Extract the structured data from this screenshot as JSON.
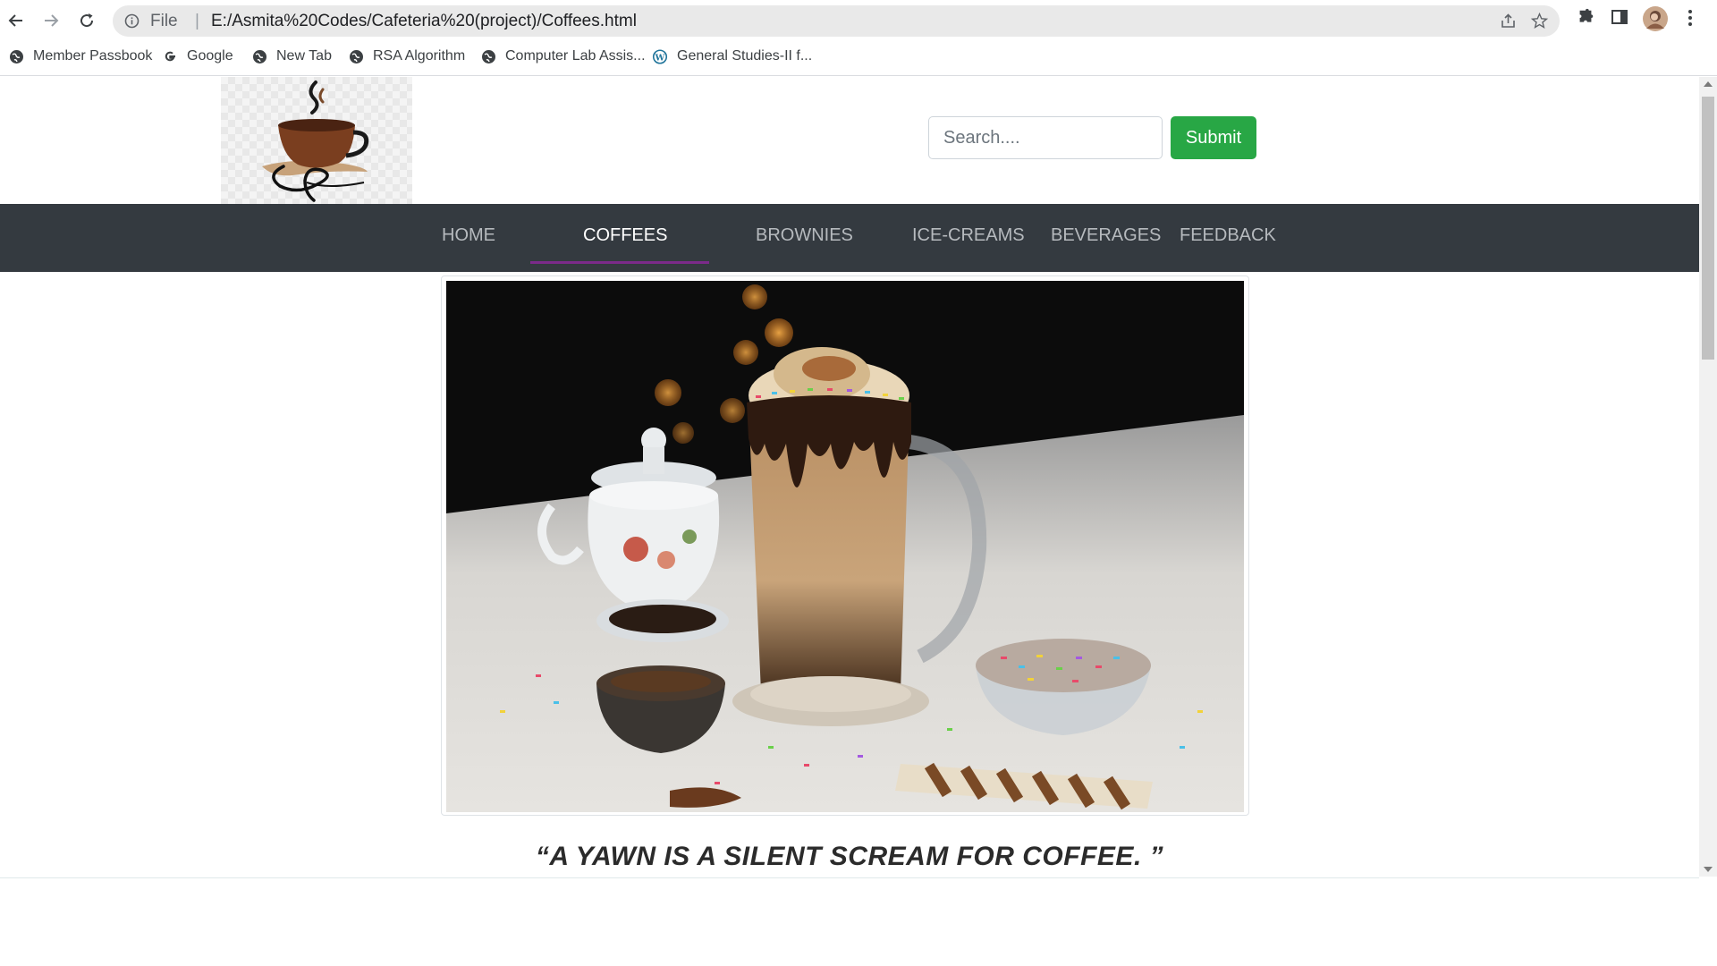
{
  "browser": {
    "omnibox": {
      "scheme_label": "File",
      "separator": "|",
      "url": "E:/Asmita%20Codes/Cafeteria%20(project)/Coffees.html"
    },
    "bookmarks": [
      {
        "label": "Member Passbook",
        "icon": "globe-icon"
      },
      {
        "label": "Google",
        "icon": "google-icon"
      },
      {
        "label": "New Tab",
        "icon": "globe-icon"
      },
      {
        "label": "RSA Algorithm",
        "icon": "globe-icon"
      },
      {
        "label": "Computer Lab Assis...",
        "icon": "globe-icon"
      },
      {
        "label": "General Studies-II f...",
        "icon": "wordpress-icon"
      }
    ]
  },
  "site": {
    "search": {
      "placeholder": "Search....",
      "value": ""
    },
    "submit_label": "Submit",
    "nav": [
      {
        "label": "HOME",
        "active": false
      },
      {
        "label": "COFFEES",
        "active": true
      },
      {
        "label": "BROWNIES",
        "active": false
      },
      {
        "label": "ICE-CREAMS",
        "active": false
      },
      {
        "label": "BEVERAGES",
        "active": false
      },
      {
        "label": "FEEDBACK",
        "active": false
      }
    ],
    "quote": "“A YAWN IS A SILENT SCREAM FOR COFFEE. ”",
    "colors": {
      "navbar_bg": "#343a40",
      "nav_active_underline": "#7b2a8a",
      "submit_bg": "#28a745"
    }
  }
}
